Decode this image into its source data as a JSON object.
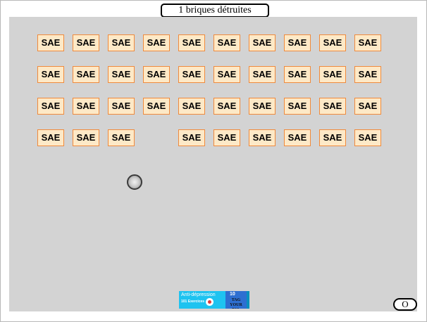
{
  "counter_text": "1 briques détruites",
  "brick_label": "SAE",
  "bricks": [
    [
      true,
      true,
      true,
      true,
      true,
      true,
      true,
      true,
      true,
      true
    ],
    [
      true,
      true,
      true,
      true,
      true,
      true,
      true,
      true,
      true,
      true
    ],
    [
      true,
      true,
      true,
      true,
      true,
      true,
      true,
      true,
      true,
      true
    ],
    [
      true,
      true,
      true,
      false,
      true,
      true,
      true,
      true,
      true,
      true
    ]
  ],
  "paddle": {
    "title": "Anti-dépression",
    "subtitle": "101 Exercices",
    "number": "10",
    "brand": "TAG YOUR PAL"
  },
  "corner_button_label": "O",
  "colors": {
    "playfield": "#d3d3d3",
    "brick_fill": "#fde9c7",
    "brick_border": "#f08a3c",
    "paddle": "#1ec3f0"
  }
}
